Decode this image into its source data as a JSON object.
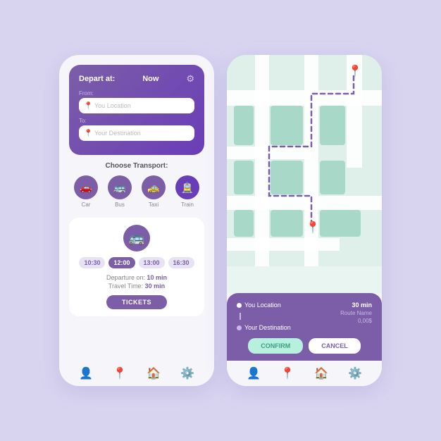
{
  "background": "#d8d4f0",
  "accent": "#7b5ea7",
  "phone_left": {
    "header": {
      "depart_label": "Depart at:",
      "depart_value": "Now",
      "from_label": "From:",
      "from_placeholder": "You Location",
      "to_label": "To:",
      "to_placeholder": "Your Destination"
    },
    "transport": {
      "title": "Choose Transport:",
      "items": [
        {
          "label": "Car",
          "icon": "🚗"
        },
        {
          "label": "Bus",
          "icon": "🚌"
        },
        {
          "label": "Taxi",
          "icon": "🚕"
        },
        {
          "label": "Train",
          "icon": "🚊"
        }
      ]
    },
    "schedule": {
      "times": [
        "10:30",
        "12:00",
        "13:00",
        "16:30"
      ],
      "selected_index": 1,
      "departure_label": "Departure on:",
      "departure_value": "10 min",
      "travel_label": "Travel Time:",
      "travel_value": "30 min",
      "tickets_btn": "TICKETS"
    },
    "nav": {
      "items": [
        {
          "icon": "👤",
          "name": "profile"
        },
        {
          "icon": "📍",
          "name": "location"
        },
        {
          "icon": "🏠",
          "name": "home"
        },
        {
          "icon": "⚙️",
          "name": "settings"
        }
      ]
    }
  },
  "phone_right": {
    "map": {
      "origin_pin_label": "origin",
      "dest_pin_label": "destination"
    },
    "info_card": {
      "origin": "You Location",
      "destination": "Your Destination",
      "time": "30 min",
      "route_name": "Route Name",
      "price": "0,00$",
      "confirm_btn": "CONFIRM",
      "cancel_btn": "CANCEL"
    },
    "nav": {
      "items": [
        {
          "icon": "👤",
          "name": "profile"
        },
        {
          "icon": "📍",
          "name": "location"
        },
        {
          "icon": "🏠",
          "name": "home"
        },
        {
          "icon": "⚙️",
          "name": "settings"
        }
      ]
    }
  }
}
